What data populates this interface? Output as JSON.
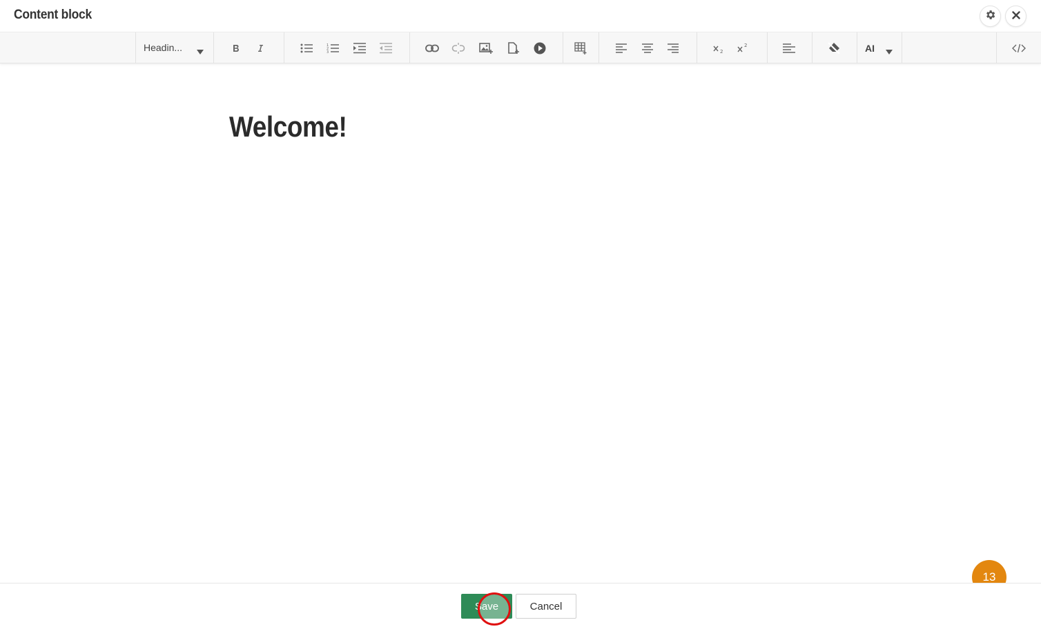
{
  "header": {
    "title": "Content block",
    "settings_icon": "gear-icon",
    "close_icon": "close-icon"
  },
  "toolbar": {
    "format_dropdown": {
      "selected": "Headin..."
    },
    "ai_menu": {
      "label": "AI"
    },
    "groups": [
      [
        "bold-icon",
        "italic-icon"
      ],
      [
        "bulleted-list-icon",
        "numbered-list-icon",
        "indent-icon",
        "outdent-icon"
      ],
      [
        "link-icon",
        "unlink-icon",
        "insert-image-icon",
        "insert-file-icon",
        "insert-media-icon"
      ],
      [
        "insert-table-icon"
      ],
      [
        "align-left-icon",
        "align-center-icon",
        "align-right-icon"
      ],
      [
        "subscript-icon",
        "superscript-icon"
      ],
      [
        "paragraph-styles-icon"
      ],
      [
        "clear-formatting-icon"
      ],
      [
        "ai-menu"
      ],
      [
        "html-source-icon"
      ]
    ]
  },
  "editor": {
    "heading": "Welcome!"
  },
  "footer": {
    "save_label": "Save",
    "cancel_label": "Cancel"
  },
  "notification_badge": {
    "count": "13"
  },
  "colors": {
    "save_button": "#2e8b57",
    "badge": "#e3870f",
    "click_marker": "#e01010",
    "toolbar_bg": "#f7f7f7"
  }
}
